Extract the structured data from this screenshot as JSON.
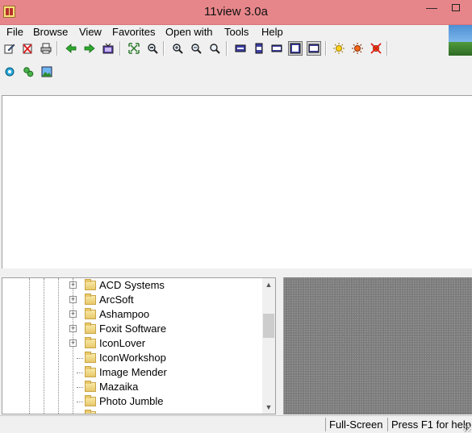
{
  "window": {
    "title": "11view 3.0a",
    "minimize_label": "—"
  },
  "menu": [
    "File",
    "Browse",
    "View",
    "Favorites",
    "Open with",
    "Tools",
    "Help"
  ],
  "toolbar1": [
    {
      "name": "edit-icon"
    },
    {
      "name": "delete-icon"
    },
    {
      "name": "print-icon"
    },
    {
      "name": "sep"
    },
    {
      "name": "back-arrow-icon"
    },
    {
      "name": "forward-arrow-icon"
    },
    {
      "name": "slideshow-icon"
    },
    {
      "name": "sep"
    },
    {
      "name": "fit-window-icon"
    },
    {
      "name": "zoom-search-icon"
    },
    {
      "name": "sep"
    },
    {
      "name": "zoom-in-icon"
    },
    {
      "name": "zoom-out-icon"
    },
    {
      "name": "zoom-actual-icon"
    },
    {
      "name": "sep"
    },
    {
      "name": "layout-1-icon"
    },
    {
      "name": "layout-2-icon"
    },
    {
      "name": "layout-3-icon"
    },
    {
      "name": "layout-4-icon"
    },
    {
      "name": "layout-5-icon"
    },
    {
      "name": "sep"
    },
    {
      "name": "brightness-icon"
    },
    {
      "name": "color-icon"
    },
    {
      "name": "effects-icon"
    }
  ],
  "toolbar2": [
    {
      "name": "settings-gear-icon"
    },
    {
      "name": "plugins-icon"
    },
    {
      "name": "wallpaper-icon"
    }
  ],
  "tree": {
    "items": [
      {
        "label": "ACD Systems",
        "expandable": true
      },
      {
        "label": "ArcSoft",
        "expandable": true
      },
      {
        "label": "Ashampoo",
        "expandable": true
      },
      {
        "label": "Foxit Software",
        "expandable": true
      },
      {
        "label": "IconLover",
        "expandable": true
      },
      {
        "label": "IconWorkshop",
        "expandable": false
      },
      {
        "label": "Image Mender",
        "expandable": false
      },
      {
        "label": "Mazaika",
        "expandable": false
      },
      {
        "label": "Photo Jumble",
        "expandable": false
      }
    ],
    "scroll_up": "▲",
    "scroll_down": "▼"
  },
  "status": {
    "mode": "Full-Screen",
    "help": "Press F1 for help"
  }
}
